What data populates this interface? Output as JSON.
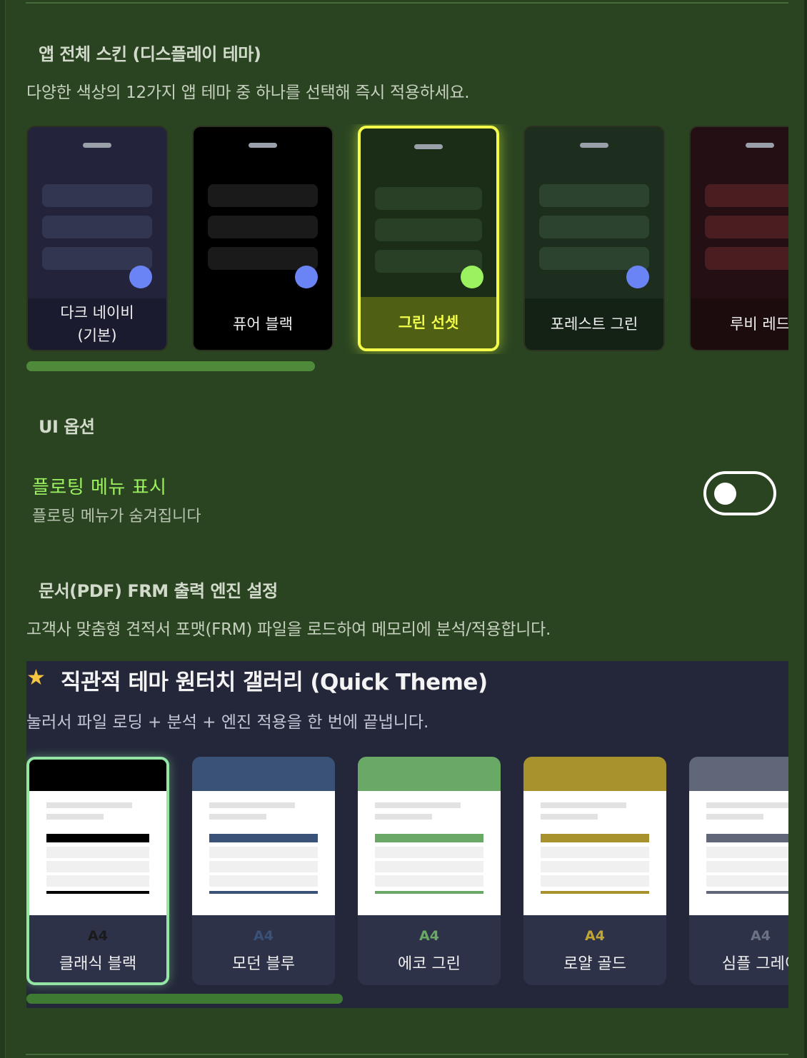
{
  "skin_section": {
    "title": "앱 전체 스킨 (디스플레이 테마)",
    "description": "다양한 색상의 12가지 앱 테마 중 하나를 선택해 즉시 적용하세요.",
    "skins": [
      {
        "line1": "다크 네이비",
        "line2": "(기본)",
        "selected": false,
        "bg": "#23243c",
        "bar": "#323650",
        "footer": "#1a1b2e",
        "dot": "#6b84f5"
      },
      {
        "line1": "퓨어 블랙",
        "line2": "",
        "selected": false,
        "bg": "#000000",
        "bar": "#1a1a1a",
        "footer": "#000000",
        "dot": "#6b84f5"
      },
      {
        "line1": "그린 선셋",
        "line2": "",
        "selected": true,
        "bg": "#1b2c17",
        "bar": "#2a4026",
        "footer": "#4f5f14",
        "dot": "#9cf25e"
      },
      {
        "line1": "포레스트 그린",
        "line2": "",
        "selected": false,
        "bg": "#1d2e1f",
        "bar": "#2c4330",
        "footer": "#142216",
        "dot": "#6b84f5"
      },
      {
        "line1": "루비 레드",
        "line2": "",
        "selected": false,
        "bg": "#241014",
        "bar": "#4a1e20",
        "footer": "#1c0c0e",
        "dot": "#6b84f5"
      }
    ]
  },
  "ui_options": {
    "title": "UI 옵션",
    "floating_menu_label": "플로팅 메뉴 표시",
    "floating_menu_status": "플로팅 메뉴가 숨겨집니다",
    "floating_menu_enabled": false
  },
  "pdf_section": {
    "title": "문서(PDF) FRM 출력 엔진 설정",
    "description": "고객사 맞춤형 견적서 포맷(FRM) 파일을 로드하여 메모리에 분석/적용합니다."
  },
  "quick_theme": {
    "icon": "star-icon",
    "title": "직관적 테마 원터치 갤러리 (Quick Theme)",
    "description": "눌러서 파일 로딩 + 분석 + 엔진 적용을 한 번에 끝냅니다.",
    "themes": [
      {
        "size": "A4",
        "name": "클래식 블랙",
        "selected": true,
        "color": "#000000",
        "size_color": "#1a1a1a"
      },
      {
        "size": "A4",
        "name": "모던 블루",
        "selected": false,
        "color": "#3a5178",
        "size_color": "#3a5178"
      },
      {
        "size": "A4",
        "name": "에코 그린",
        "selected": false,
        "color": "#69a865",
        "size_color": "#69a865"
      },
      {
        "size": "A4",
        "name": "로얄 골드",
        "selected": false,
        "color": "#a8922e",
        "size_color": "#c2a632"
      },
      {
        "size": "A4",
        "name": "심플 그레이",
        "selected": false,
        "color": "#5f6778",
        "size_color": "#6a7285"
      }
    ]
  }
}
